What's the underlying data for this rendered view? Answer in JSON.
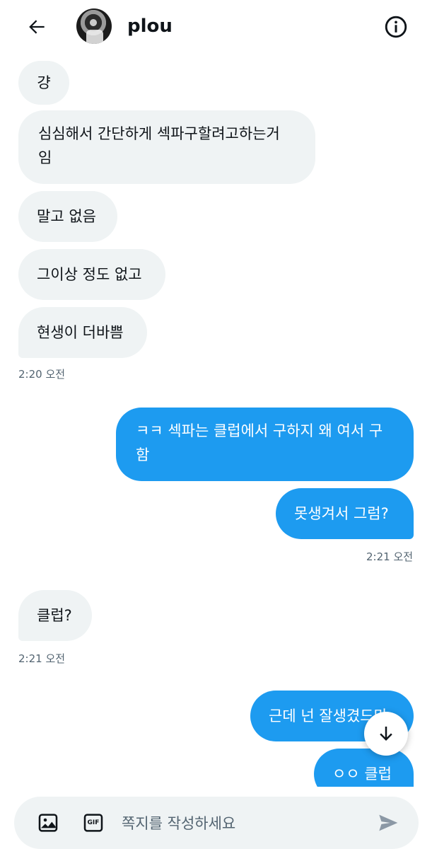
{
  "header": {
    "username": "plou",
    "back_icon": "arrow-left-icon",
    "info_icon": "info-circle-icon"
  },
  "messages": [
    {
      "direction": "in",
      "text": "걍"
    },
    {
      "direction": "in",
      "text": "심심해서 간단하게 섹파구할려고하는거\n임"
    },
    {
      "direction": "in",
      "text": "말고 없음"
    },
    {
      "direction": "in",
      "text": "그이상 정도 없고"
    },
    {
      "direction": "in",
      "text": "현생이 더바쁨"
    },
    {
      "direction": "out",
      "text": "ㅋㅋ 섹파는 클럽에서 구하지 왜 여서 구\n함"
    },
    {
      "direction": "out",
      "text": "못생겨서 그럼?"
    },
    {
      "direction": "in",
      "text": "클럽?"
    },
    {
      "direction": "out",
      "text": "근데 넌 잘생겼드만"
    },
    {
      "direction": "out",
      "text": "ㅇㅇ 클럽"
    }
  ],
  "timestamps": [
    "2:20 오전",
    "2:21 오전",
    "2:21 오전"
  ],
  "composer": {
    "placeholder": "쪽지를 작성하세요",
    "image_icon": "image-icon",
    "gif_icon": "gif-icon",
    "gif_label": "GIF",
    "send_icon": "send-icon"
  },
  "scroll_button_icon": "arrow-down-icon",
  "colors": {
    "outgoing_bubble": "#1d9bf0",
    "incoming_bubble": "#eff3f4",
    "timestamp_text": "#536471"
  }
}
